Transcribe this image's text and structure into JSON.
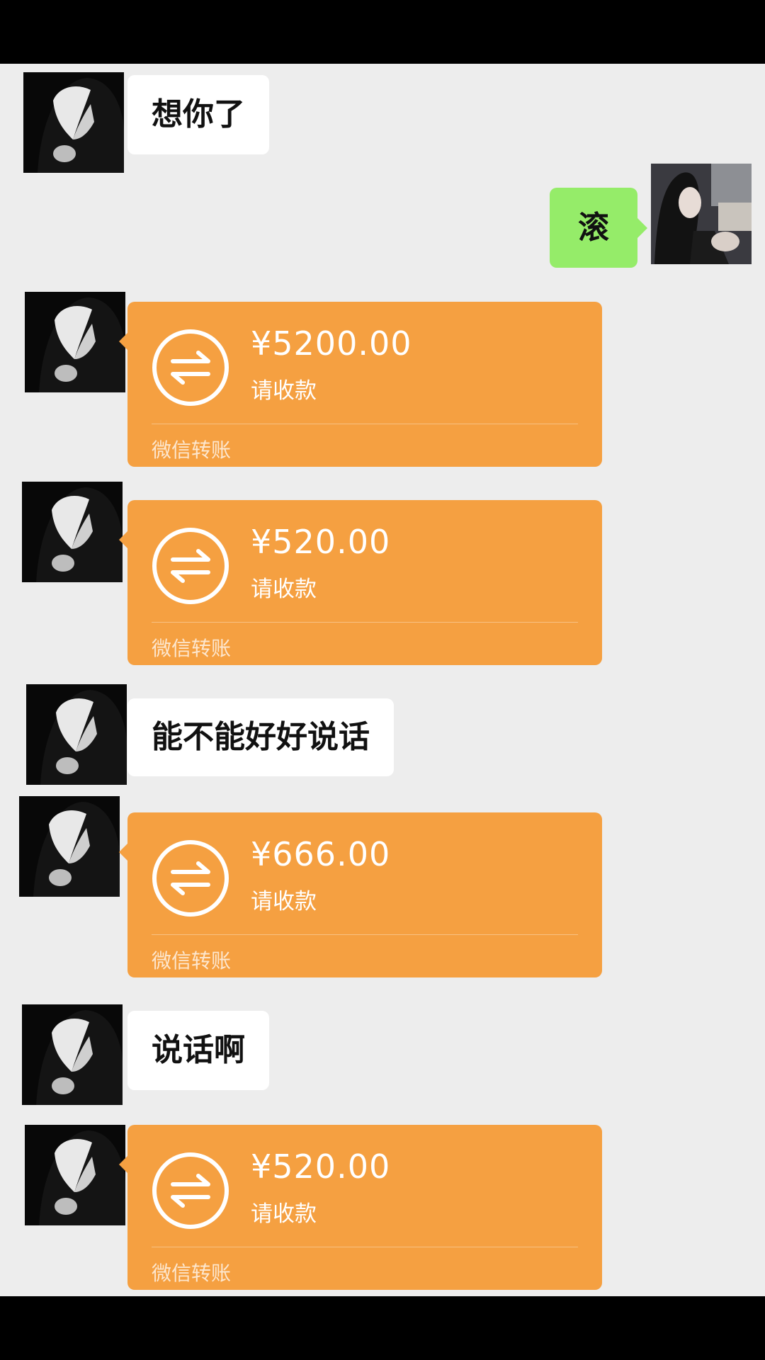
{
  "messages": [
    {
      "type": "text",
      "from": "them",
      "text": "想你了"
    },
    {
      "type": "text",
      "from": "me",
      "text": "滚"
    },
    {
      "type": "transfer",
      "from": "them",
      "amount": "¥5200.00",
      "status": "请收款",
      "footer": "微信转账"
    },
    {
      "type": "transfer",
      "from": "them",
      "amount": "¥520.00",
      "status": "请收款",
      "footer": "微信转账"
    },
    {
      "type": "text",
      "from": "them",
      "text": "能不能好好说话"
    },
    {
      "type": "transfer",
      "from": "them",
      "amount": "¥666.00",
      "status": "请收款",
      "footer": "微信转账"
    },
    {
      "type": "text",
      "from": "them",
      "text": "说话啊"
    },
    {
      "type": "transfer",
      "from": "them",
      "amount": "¥520.00",
      "status": "请收款",
      "footer": "微信转账"
    }
  ],
  "colors": {
    "chat_background": "#ededed",
    "transfer_orange": "#f5a041",
    "my_bubble_green": "#95ec69",
    "their_bubble_white": "#ffffff"
  },
  "icons": {
    "transfer": "transfer-arrows-icon",
    "avatar_them": "hooded-figure-avatar",
    "avatar_me": "girl-photo-avatar"
  }
}
